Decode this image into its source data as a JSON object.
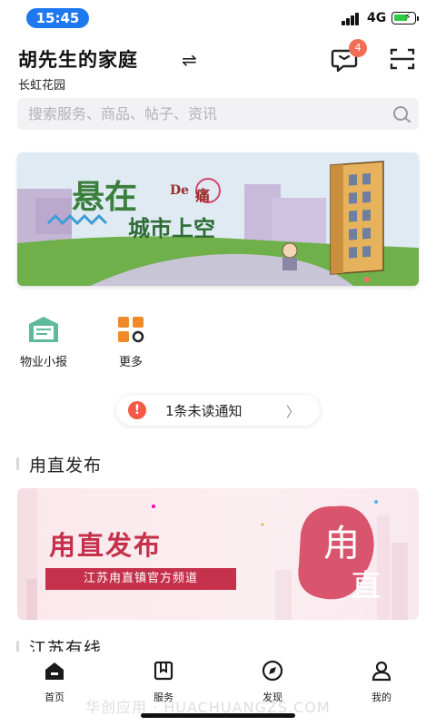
{
  "status": {
    "time": "15:45",
    "network": "4G"
  },
  "header": {
    "title": "胡先生的家庭",
    "swap_icon": "⇌",
    "community": "长虹花园",
    "message_badge": "4",
    "message_icon": "message-icon",
    "scan_icon": "scan-icon"
  },
  "search": {
    "placeholder": "搜索服务、商品、帖子、资讯"
  },
  "banner": {
    "title": "悬在",
    "de": "De",
    "tong": "痛",
    "subtitle": "城市上空"
  },
  "quick_entries": [
    {
      "label": "物业小报",
      "icon": "bulletin-icon"
    },
    {
      "label": "更多",
      "icon": "more-grid-icon"
    }
  ],
  "notify": {
    "icon": "!",
    "text": "1条未读通知",
    "arrow": "〉"
  },
  "sections": [
    {
      "title": "甪直发布",
      "card": {
        "title": "甪直发布",
        "tag": "江苏甪直镇官方频道",
        "seal_top": "甪",
        "seal_bottom": "直"
      }
    },
    {
      "title": "江苏有线"
    }
  ],
  "tabbar": [
    {
      "label": "首页",
      "icon": "home-icon",
      "active": true
    },
    {
      "label": "服务",
      "icon": "service-icon",
      "active": false
    },
    {
      "label": "发现",
      "icon": "discover-icon",
      "active": false
    },
    {
      "label": "我的",
      "icon": "profile-icon",
      "active": false
    }
  ],
  "watermark": "华创应用 · HUACHUANGZS.COM",
  "colors": {
    "accent": "#1e79f0",
    "badge": "#f36d57",
    "brand_red": "#c5314b",
    "banner_green": "#3a7f3c",
    "orange": "#ef8a2a"
  }
}
